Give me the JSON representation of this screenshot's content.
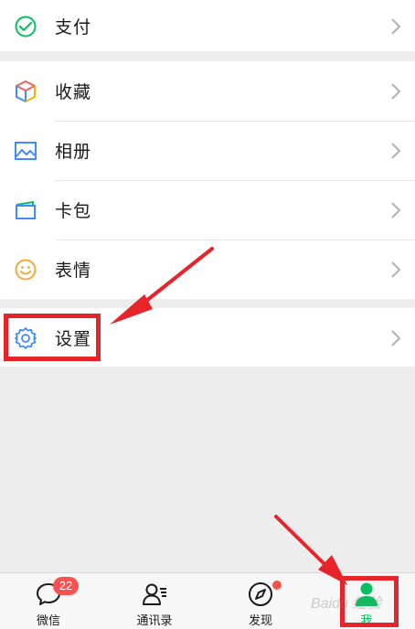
{
  "menu": {
    "pay_label": "支付",
    "favorites_label": "收藏",
    "album_label": "相册",
    "cards_label": "卡包",
    "stickers_label": "表情",
    "settings_label": "设置"
  },
  "tabbar": {
    "chats_label": "微信",
    "chats_badge": "22",
    "contacts_label": "通讯录",
    "discover_label": "发现",
    "me_label": "我"
  },
  "icons": {
    "pay": "wallet-icon",
    "favorites": "cube-icon",
    "album": "image-icon",
    "cards": "card-icon",
    "stickers": "smiley-icon",
    "settings": "gear-icon",
    "chats": "chat-bubble-icon",
    "contacts": "contacts-icon",
    "discover": "compass-icon",
    "me": "person-icon"
  },
  "watermark": "Baidu 经验",
  "colors": {
    "accent": "#07c160",
    "annotation": "#e8242b",
    "badge": "#fa5151",
    "background": "#ededed"
  }
}
